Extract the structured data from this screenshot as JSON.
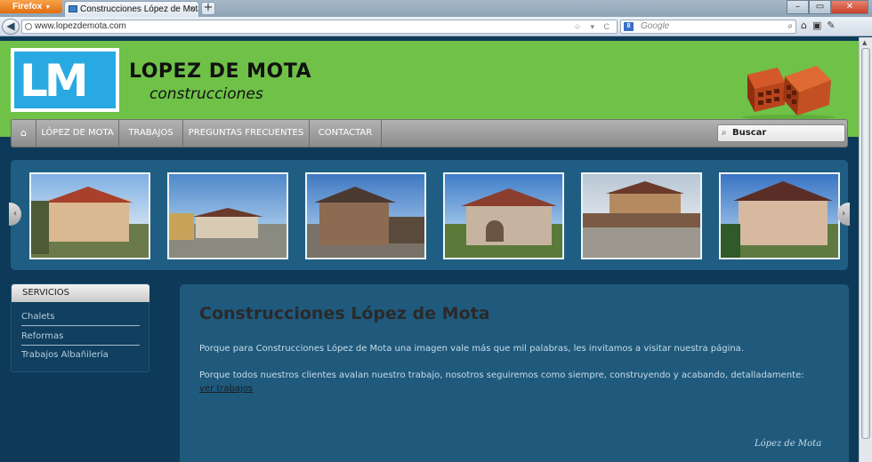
{
  "browser": {
    "app_button": "Firefox",
    "tab_title": "Construcciones López de Mota ...",
    "new_tab": "+",
    "url": "www.lopezdemota.com",
    "search_placeholder": "Google",
    "window_buttons": [
      "–",
      "▭",
      "✕"
    ]
  },
  "site": {
    "logo_text": "LM",
    "brand_title": "LOPEZ DE MOTA",
    "brand_subtitle": "construcciones",
    "menu": {
      "items": [
        "LÓPEZ DE MOTA",
        "TRABAJOS",
        "PREGUNTAS FRECUENTES",
        "CONTACTAR"
      ],
      "search_label": "Buscar"
    },
    "sidebar": {
      "title": "SERVICIOS",
      "links": [
        "Chalets",
        "Reformas",
        "Trabajos Albañilería"
      ]
    },
    "content": {
      "heading": "Construcciones López de Mota",
      "paragraph1": "Porque para Construcciones López de Mota una imagen vale más que mil palabras, les invitamos a visitar nuestra página.",
      "paragraph2": "Porque todos nuestros clientes avalan nuestro trabajo, nosotros seguiremos como siempre, construyendo y acabando, detalladamente:",
      "link_text": "ver trabajos",
      "signature": "López de Mota"
    }
  },
  "colors": {
    "header_green": "#6fc148",
    "logo_blue": "#29a9e1",
    "page_bg": "#0e3a5a",
    "panel_bg": "#1f5a7d"
  }
}
